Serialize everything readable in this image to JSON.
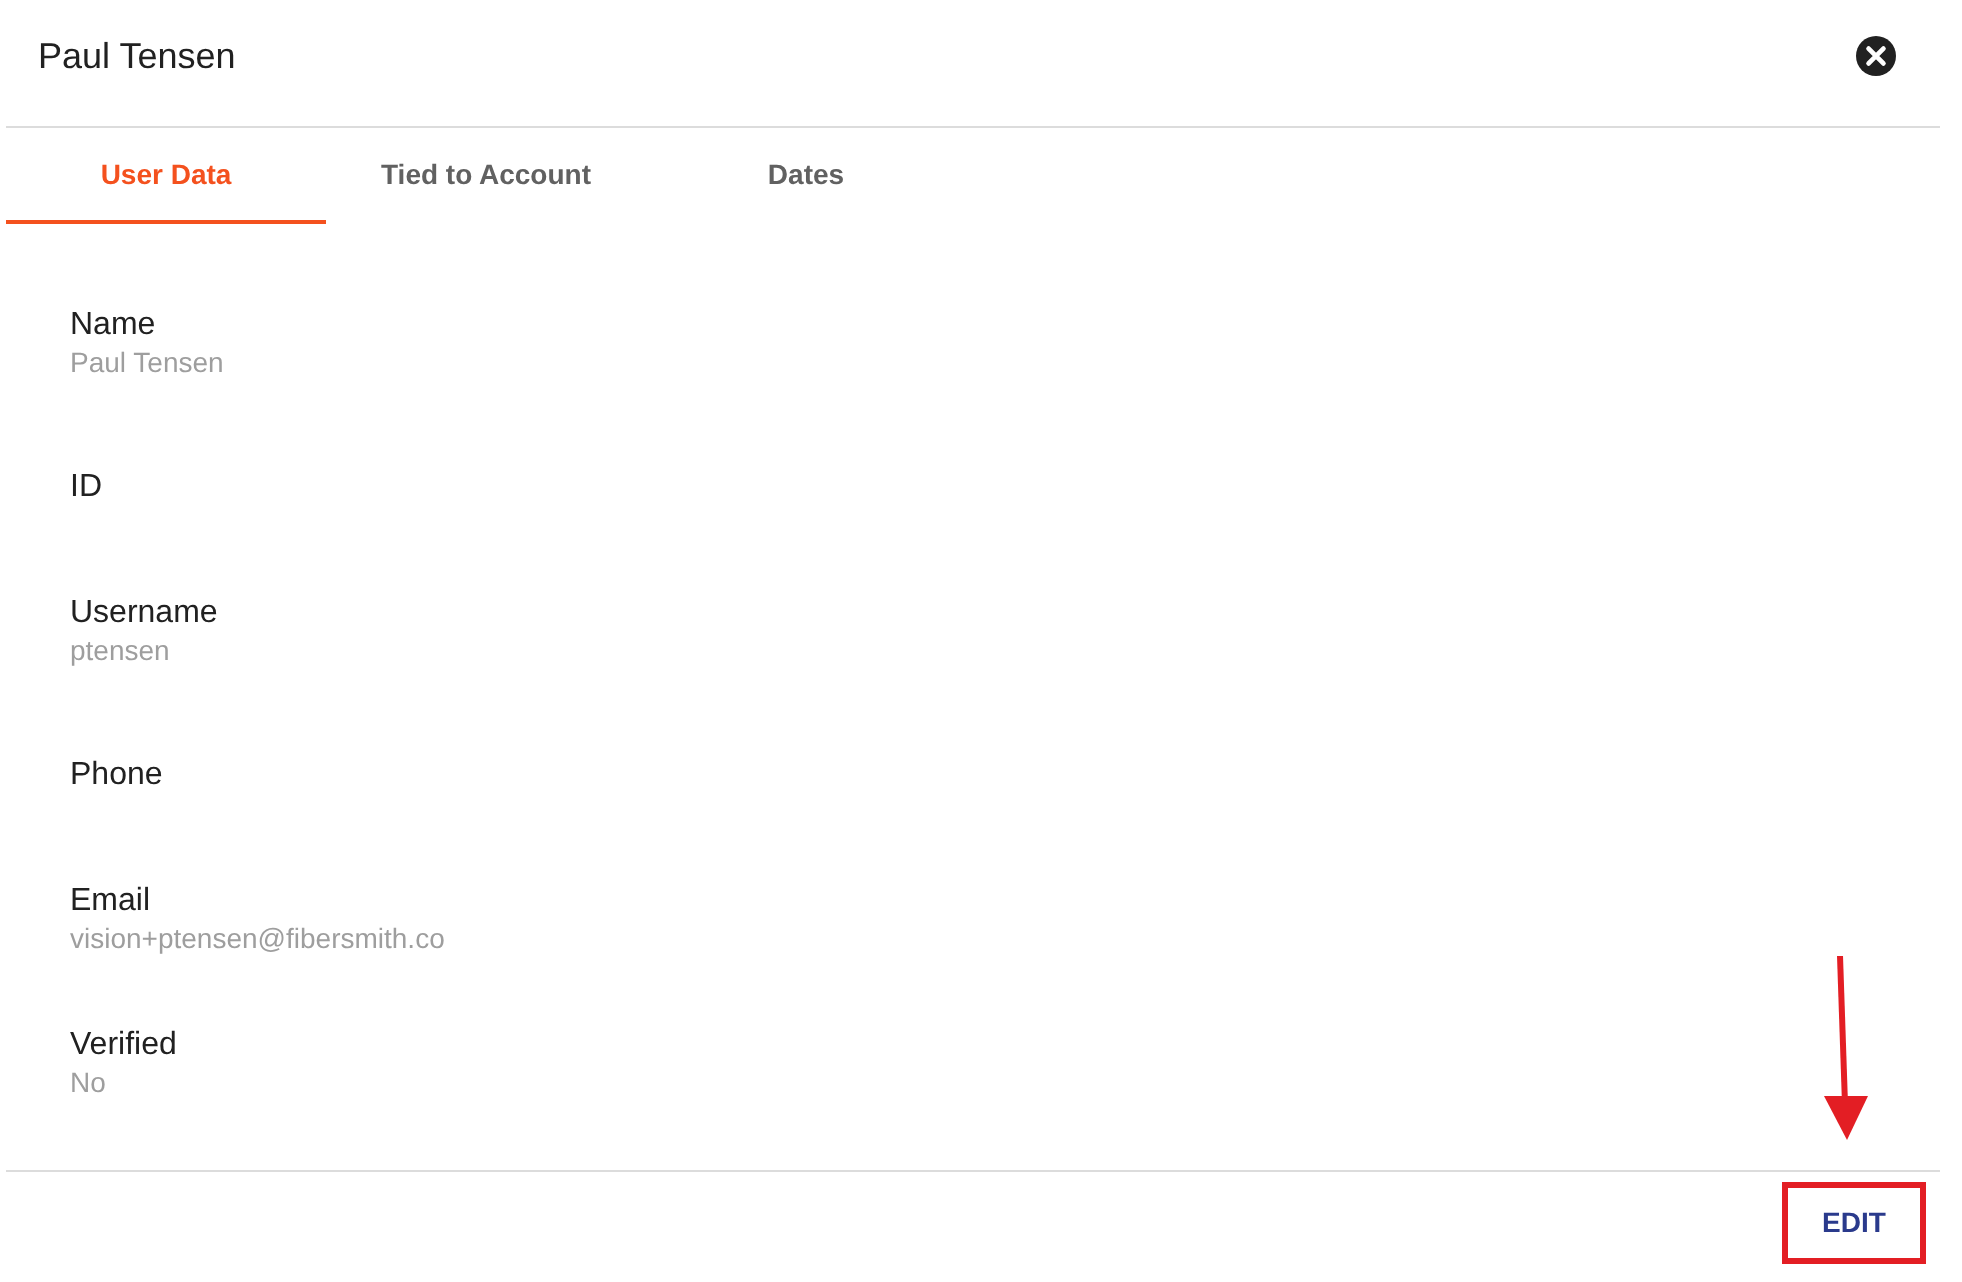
{
  "window": {
    "title": "Paul Tensen"
  },
  "tabs": [
    {
      "label": "User Data",
      "selected": true
    },
    {
      "label": "Tied to Account",
      "selected": false
    },
    {
      "label": "Dates",
      "selected": false
    }
  ],
  "fields": [
    {
      "label": "Name",
      "value": "Paul Tensen"
    },
    {
      "label": "ID"
    },
    {
      "label": "Username",
      "value": "ptensen"
    },
    {
      "label": "Phone"
    },
    {
      "label": "Email",
      "value": "vision+ptensen@fibersmith.co"
    },
    {
      "label": "Verified",
      "value": "No"
    }
  ],
  "actions": [
    {
      "label": "EDIT",
      "highlighted": true
    }
  ]
}
